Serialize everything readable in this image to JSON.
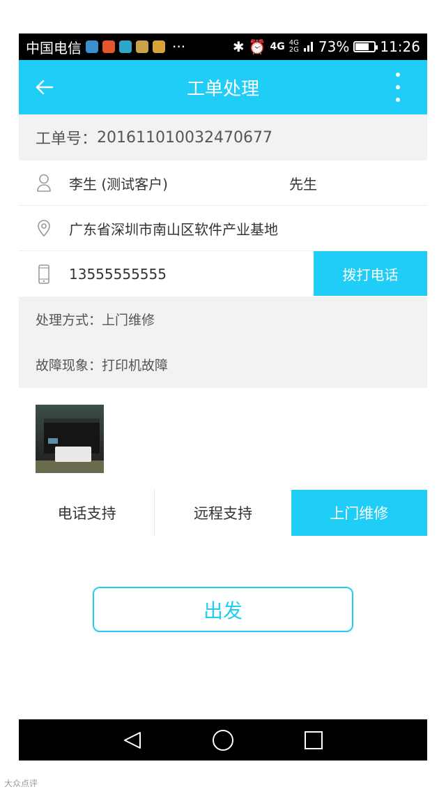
{
  "status_bar": {
    "carrier": "中国电信",
    "overflow": "···",
    "network": "4G",
    "network_small_top": "4G",
    "network_small_bottom": "2G",
    "battery_percent_text": "73%",
    "battery_level": 0.73,
    "time": "11:26",
    "app_icon_colors": [
      "#3a8fd0",
      "#e4572e",
      "#2fa8c7",
      "#c9a24a",
      "#d8a43a"
    ]
  },
  "header": {
    "title": "工单处理",
    "back_icon": "arrow-left-icon",
    "more_icon": "more-vertical-icon"
  },
  "order": {
    "label": "工单号：",
    "number": "201611010032470677"
  },
  "customer": {
    "name": "李生 (测试客户)",
    "gender": "先生",
    "address": "广东省深圳市南山区软件产业基地",
    "phone": "13555555555",
    "call_button": "拨打电话"
  },
  "details": {
    "method_label": "处理方式：",
    "method_value": "上门维修",
    "fault_label": "故障现象：",
    "fault_value": "打印机故障"
  },
  "support_tabs": [
    {
      "label": "电话支持",
      "active": false
    },
    {
      "label": "远程支持",
      "active": false
    },
    {
      "label": "上门维修",
      "active": true
    }
  ],
  "action": {
    "depart_button": "出发"
  },
  "nav_bar": {
    "back": "nav-back-icon",
    "home": "nav-home-icon",
    "recents": "nav-recents-icon"
  },
  "colors": {
    "accent": "#1fcdf7",
    "section_bg": "#f2f2f2"
  },
  "watermark": "大众点评"
}
